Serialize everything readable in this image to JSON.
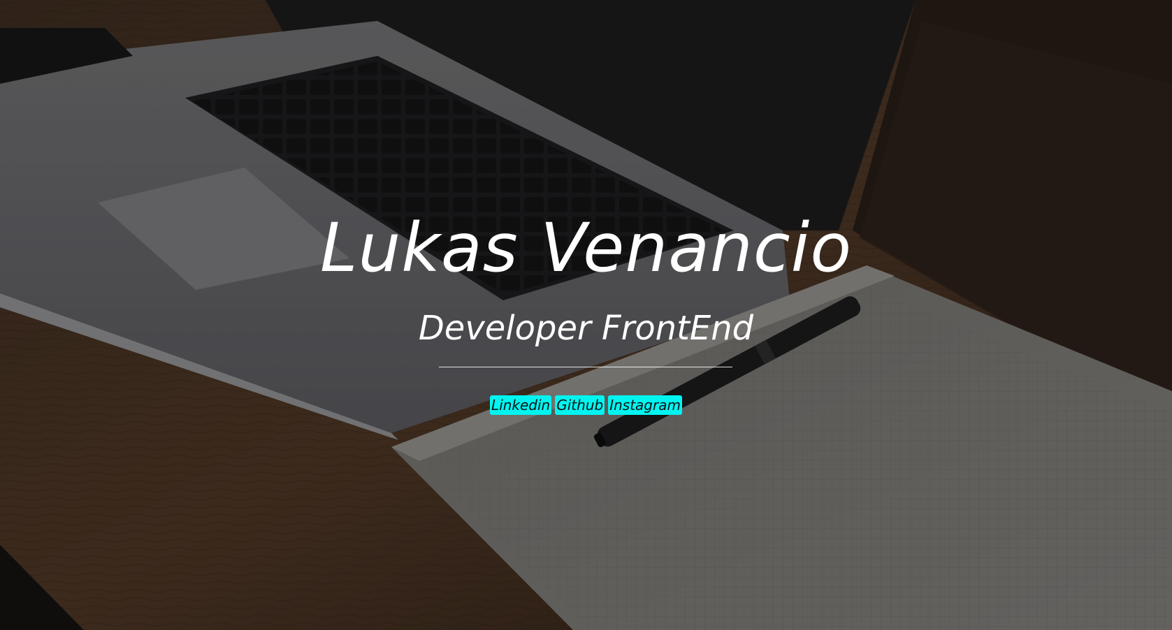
{
  "hero": {
    "name": "Lukas Venancio",
    "role": "Developer FrontEnd"
  },
  "links": [
    {
      "label": "Linkedin",
      "icon": "linkedin-link"
    },
    {
      "label": "Github",
      "icon": "github-link"
    },
    {
      "label": "Instagram",
      "icon": "instagram-link"
    }
  ],
  "colors": {
    "text": "#ffffff",
    "link_bg": "#00f5f0",
    "link_text": "#111111"
  }
}
